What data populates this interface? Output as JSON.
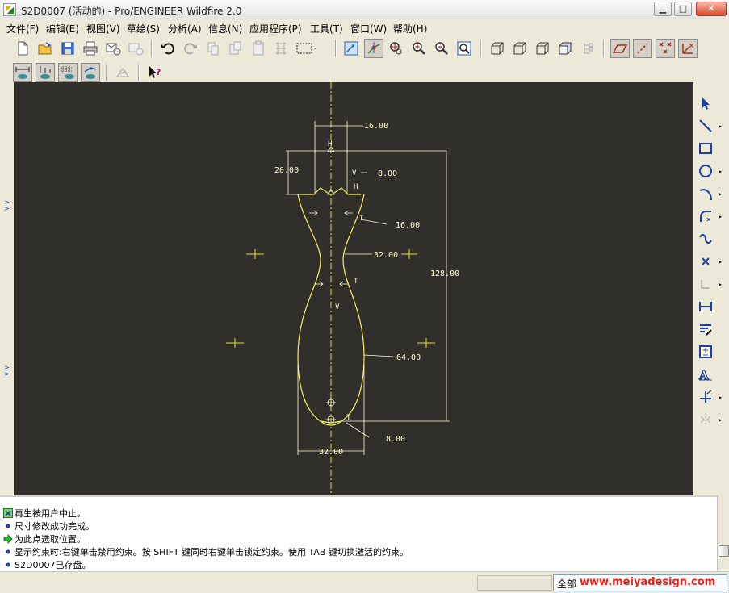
{
  "window": {
    "title": "S2D0007 (活动的) - Pro/ENGINEER Wildfire 2.0",
    "minimize_label": "▁",
    "maximize_label": "□",
    "close_label": "✕"
  },
  "menubar": {
    "items": [
      "文件(F)",
      "编辑(E)",
      "视图(V)",
      "草绘(S)",
      "分析(A)",
      "信息(N)",
      "应用程序(P)",
      "工具(T)",
      "窗口(W)",
      "帮助(H)"
    ]
  },
  "toolbar1": {
    "icons": [
      "new-icon",
      "open-icon",
      "save-icon",
      "print-icon",
      "send-email-icon",
      "email-link-icon",
      "undo-icon",
      "redo-icon",
      "cut-icon",
      "copy-icon",
      "paste-icon",
      "paste-special-icon",
      "regenerate-icon",
      "select-box-icon",
      "repaint-icon",
      "spin-center-icon",
      "orient-icon",
      "zoom-in-icon",
      "zoom-out-icon",
      "refit-icon",
      "wireframe-icon",
      "hidden-line-icon",
      "no-hidden-icon",
      "shading-icon",
      "model-tree-icon",
      "datum-planes-icon",
      "datum-axes-icon",
      "datum-points-icon",
      "coordinate-systems-icon"
    ]
  },
  "toolbar2": {
    "icons": [
      "toggle-dimensions-icon",
      "toggle-constraints-icon",
      "toggle-grid-icon",
      "toggle-vertices-icon",
      "sketch-diagnostic-icon",
      "context-help-icon"
    ]
  },
  "right_toolbar": {
    "icons": [
      "select-arrow-icon",
      "line-icon",
      "rectangle-icon",
      "circle-icon",
      "arc-icon",
      "fillet-icon",
      "spline-icon",
      "point-icon",
      "use-edge-icon",
      "dimension-icon",
      "modify-icon",
      "constrain-icon",
      "text-icon",
      "trim-icon",
      "mirror-icon"
    ]
  },
  "sketch": {
    "dimensions": [
      "16.00",
      "20.00",
      "8.00",
      "16.00",
      "32.00",
      "128.00",
      "64.00",
      "8.00",
      "32.00"
    ],
    "constraint_labels": [
      "H",
      "V",
      "H",
      "T",
      "T",
      "V",
      "T"
    ]
  },
  "messages": [
    {
      "icon": "regenerate-status-icon",
      "text": "再生被用户中止。"
    },
    {
      "icon": "info-bullet-icon",
      "text": "尺寸修改成功完成。"
    },
    {
      "icon": "prompt-arrow-icon",
      "text": "为此点选取位置。"
    },
    {
      "icon": "info-bullet-icon",
      "text": "显示约束时:右键单击禁用约束。按 SHIFT 键同时右键单击锁定约束。使用 TAB 键切换激活的约束。"
    },
    {
      "icon": "info-bullet-icon",
      "text": "S2D0007已存盘。"
    }
  ],
  "statusbar": {
    "filter_value": "全部",
    "watermark": "www.meiyadesign.com"
  },
  "colors": {
    "canvas_bg": "#302f2b",
    "sketch_yellow": "#f5f05a",
    "centerline_yellow": "#e8e020",
    "dimension_white": "#ffffd2",
    "bullet_blue": "#1c3fa8",
    "prompt_green": "#1e9a1e"
  }
}
